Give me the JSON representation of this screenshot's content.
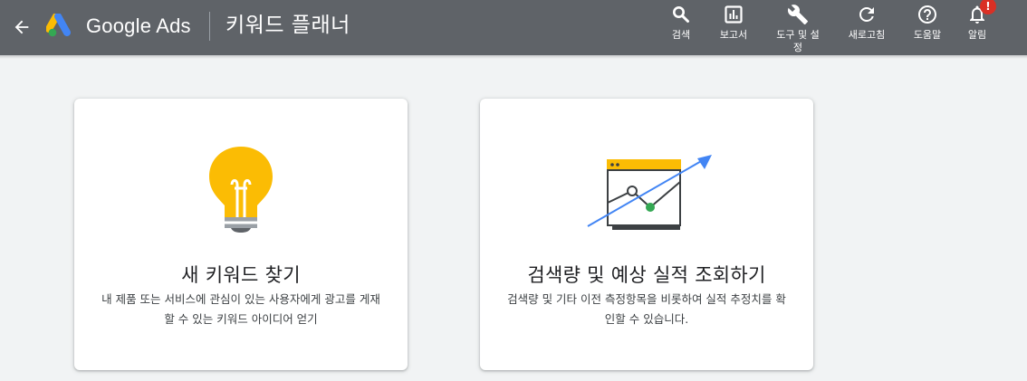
{
  "header": {
    "brand": "Google Ads",
    "page_title": "키워드 플래너",
    "tools": [
      {
        "label": "검색",
        "icon": "search-icon"
      },
      {
        "label": "보고서",
        "icon": "bar-chart-icon"
      },
      {
        "label": "도구 및 설\n정",
        "icon": "wrench-icon"
      },
      {
        "label": "새로고침",
        "icon": "refresh-icon"
      },
      {
        "label": "도움말",
        "icon": "help-icon"
      },
      {
        "label": "알림",
        "icon": "bell-icon",
        "badge": "!"
      }
    ]
  },
  "cards": [
    {
      "title": "새 키워드 찾기",
      "description": "내 제품 또는 서비스에 관심이 있는 사용자에게 광고를 게재할 수 있는 키워드 아이디어 얻기",
      "icon": "lightbulb-icon"
    },
    {
      "title": "검색량 및 예상 실적 조회하기",
      "description": "검색량 및 기타 이전 측정항목을 비롯하여 실적 추정치를 확인할 수 있습니다.",
      "icon": "trend-chart-icon"
    }
  ],
  "colors": {
    "topbar": "#5f6368",
    "background": "#f1f3f4",
    "bulb": "#fbbc04",
    "trend_arrow": "#4285f4",
    "trend_point": "#34a853",
    "badge": "#d93025"
  }
}
